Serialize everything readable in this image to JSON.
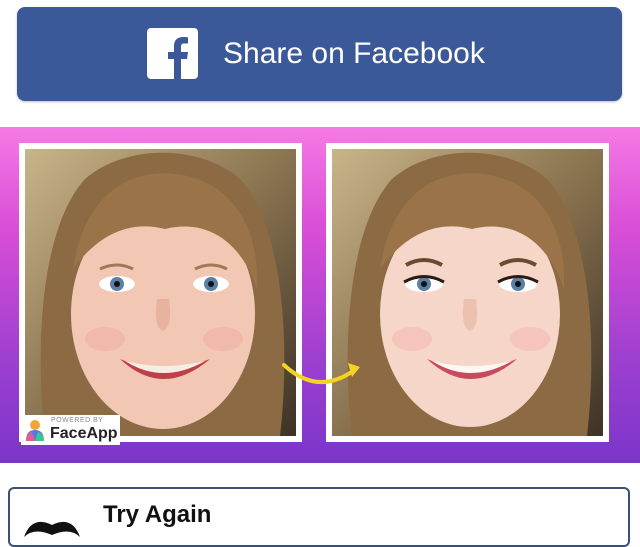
{
  "share_button": {
    "label": "Share on Facebook",
    "icon": "facebook-icon",
    "background": "#3b5998",
    "text_color": "#ffffff"
  },
  "comparison": {
    "before_image": "original-photo",
    "after_image": "edited-photo",
    "arrow_color": "#f5d323",
    "gradient_top": "#f57ae4",
    "gradient_bottom": "#7a36c9"
  },
  "watermark": {
    "powered_by": "POWERED BY",
    "brand": "FaceApp",
    "icon": "faceapp-logo-icon"
  },
  "try_again": {
    "label": "Try Again",
    "icon": "mustache-icon",
    "border_color": "#3a5173"
  }
}
